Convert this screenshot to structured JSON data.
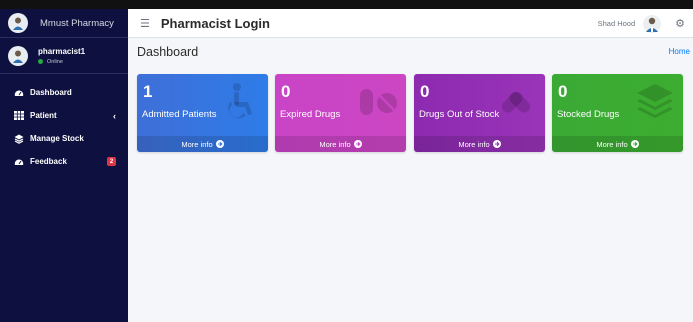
{
  "sidebar": {
    "brand": "Mmust Pharmacy",
    "user": {
      "name": "pharmacist1",
      "status": "Online"
    },
    "items": [
      {
        "label": "Dashboard",
        "icon": "dashboard-icon"
      },
      {
        "label": "Patient",
        "icon": "table-icon",
        "chevron": "‹"
      },
      {
        "label": "Manage Stock",
        "icon": "layers-icon"
      },
      {
        "label": "Feedback",
        "icon": "dashboard-icon",
        "badge": "2"
      }
    ]
  },
  "navbar": {
    "title": "Pharmacist Login",
    "user": "Shad Hood"
  },
  "content": {
    "page_title": "Dashboard",
    "breadcrumb": "Home",
    "boxes": [
      {
        "number": "1",
        "label": "Admitted Patients",
        "footer": "More info",
        "icon": "wheelchair-icon",
        "color": "#3474e0"
      },
      {
        "number": "0",
        "label": "Expired Drugs",
        "footer": "More info",
        "icon": "pills-icon",
        "color": "#ca45c5"
      },
      {
        "number": "0",
        "label": "Drugs Out of Stock",
        "footer": "More info",
        "icon": "capsules-icon",
        "color": "#9230b4"
      },
      {
        "number": "0",
        "label": "Stocked Drugs",
        "footer": "More info",
        "icon": "layers-icon",
        "color": "#3bac32"
      }
    ]
  },
  "colors": {
    "sidebar_bg": "#0e1140",
    "content_bg": "#f4f6f9",
    "link": "#007bff",
    "badge": "#dc3545"
  }
}
